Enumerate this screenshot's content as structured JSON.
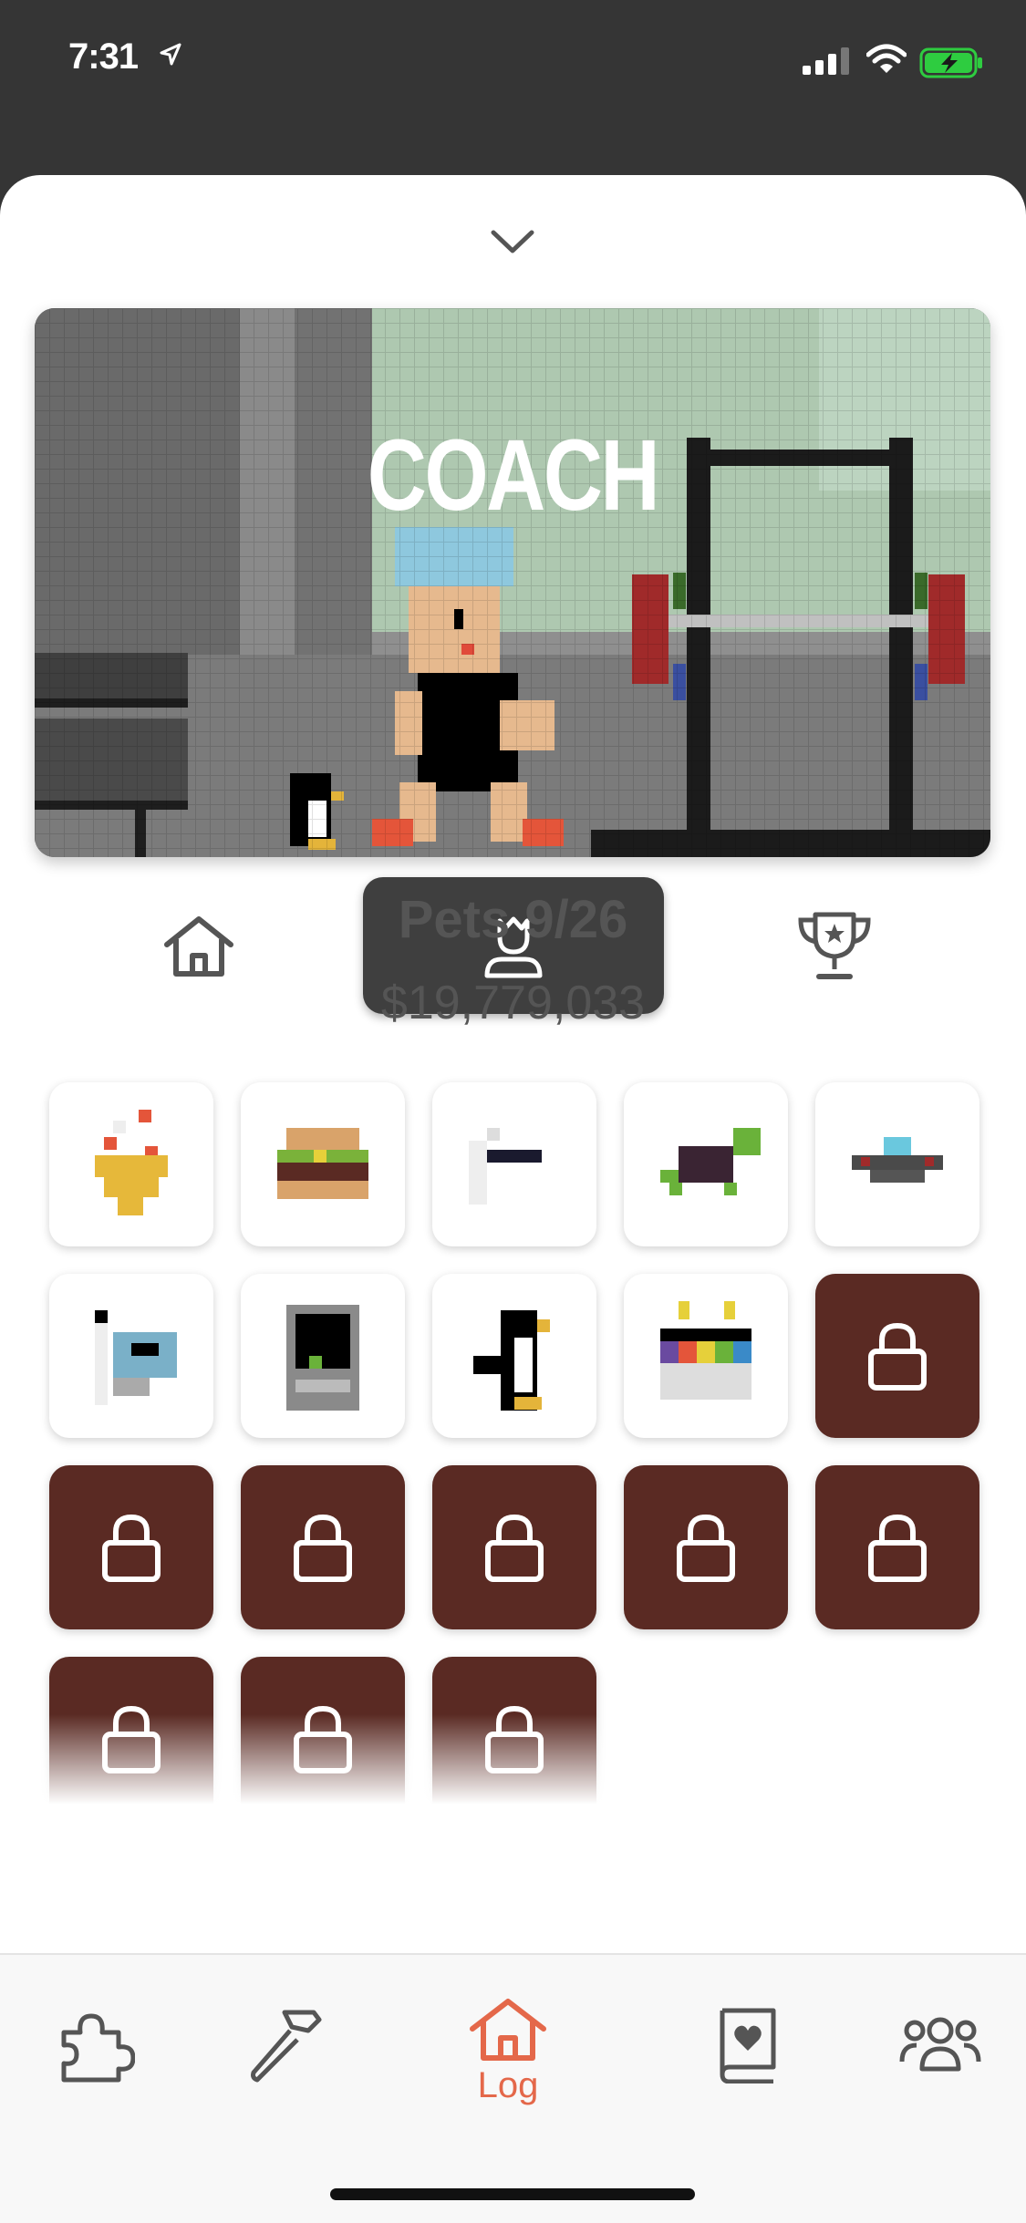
{
  "status_bar": {
    "time": "7:31",
    "location_icon": "location-arrow-icon",
    "signal_icon": "cellular-signal-icon",
    "wifi_icon": "wifi-icon",
    "battery_icon": "battery-charging-icon",
    "battery_color": "#2ecc40"
  },
  "sheet": {
    "collapse_icon": "chevron-down-icon"
  },
  "hero": {
    "title": "COACH"
  },
  "tabs": [
    {
      "name": "home",
      "icon": "home-icon",
      "selected": false
    },
    {
      "name": "pets",
      "icon": "coach-avatar-icon",
      "selected": true
    },
    {
      "name": "trophy",
      "icon": "trophy-icon",
      "selected": false
    }
  ],
  "pets": {
    "title": "Pets 9/26",
    "money": "$19,779,033",
    "unlocked": [
      "fire-pet",
      "burger-pet",
      "ghost-pet",
      "turtle-pet",
      "ufo-pet",
      "flag-pet",
      "robot-pet",
      "penguin-pet",
      "cake-pet"
    ],
    "locked_count": 17,
    "locked_color": "#5a2a23"
  },
  "bottom_nav": {
    "items": [
      {
        "icon": "puzzle-icon",
        "label": ""
      },
      {
        "icon": "hammer-icon",
        "label": ""
      },
      {
        "icon": "home-icon",
        "label": "Log",
        "active": true
      },
      {
        "icon": "book-heart-icon",
        "label": ""
      },
      {
        "icon": "group-icon",
        "label": ""
      }
    ],
    "active_color": "#e4684a",
    "inactive_color": "#555555"
  }
}
